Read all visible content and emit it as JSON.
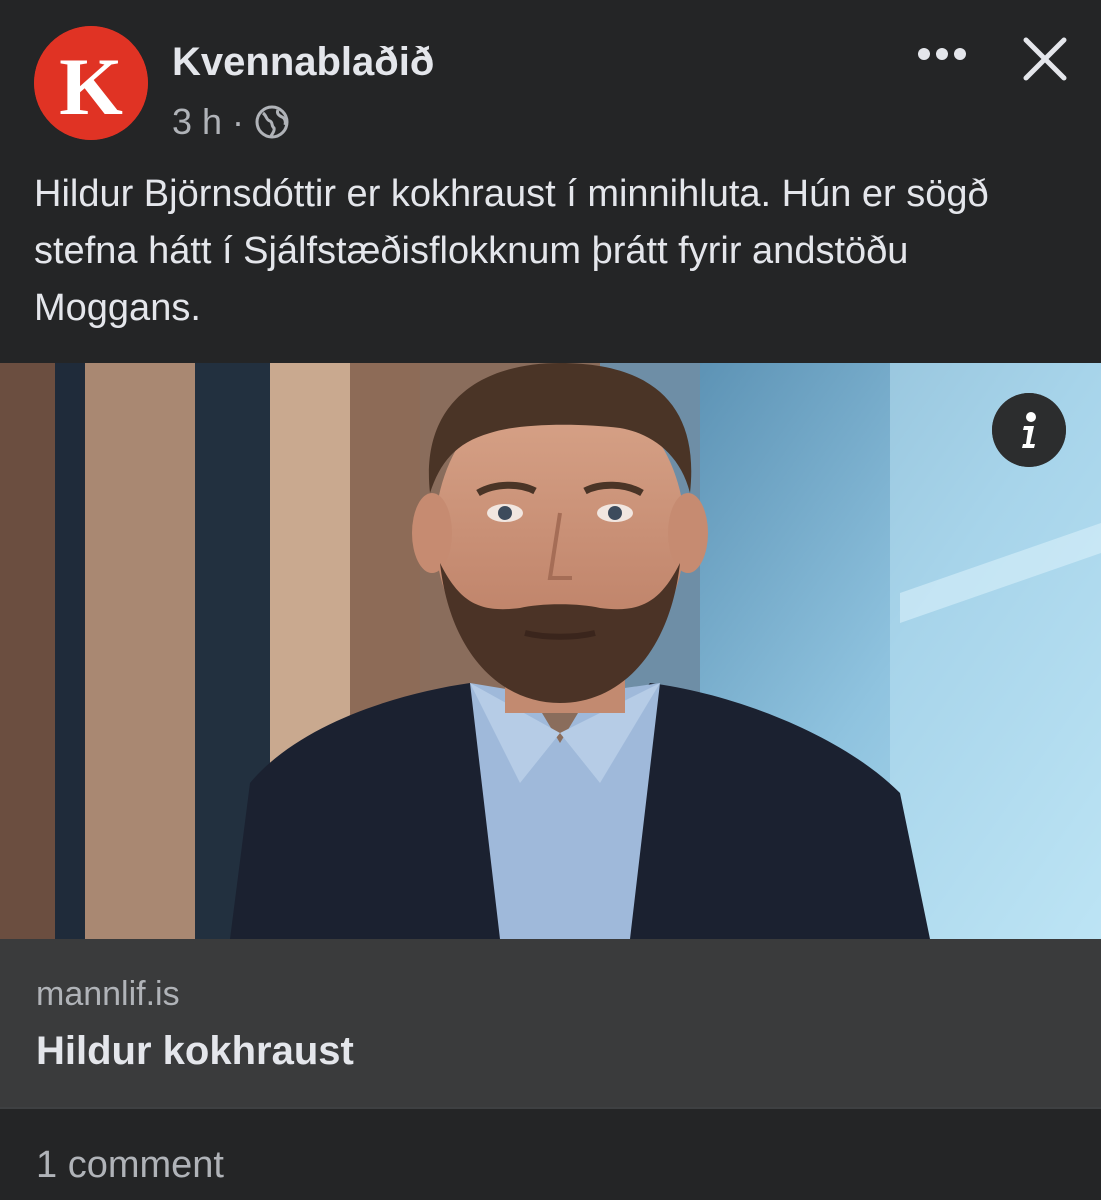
{
  "post": {
    "page_name": "Kvennablaðið",
    "avatar_letter": "K",
    "time": "3 h",
    "separator": "·",
    "privacy_icon": "globe-icon",
    "more_icon": "more-icon",
    "close_icon": "close-icon",
    "text": "Hildur Björnsdóttir er kokhraust í minnihluta. Hún er sögð stefna hátt í Sjálfstæðisflokknum þrátt fyrir andstöðu Moggans."
  },
  "link": {
    "image_icon": "info-icon",
    "domain": "mannlif.is",
    "title": "Hildur kokhraust"
  },
  "footer": {
    "comments": "1 comment"
  },
  "colors": {
    "background": "#242526",
    "avatar": "#e03324",
    "link_footer": "#3a3b3c",
    "primary_text": "#e4e6eb",
    "secondary_text": "#b0b3b8"
  }
}
